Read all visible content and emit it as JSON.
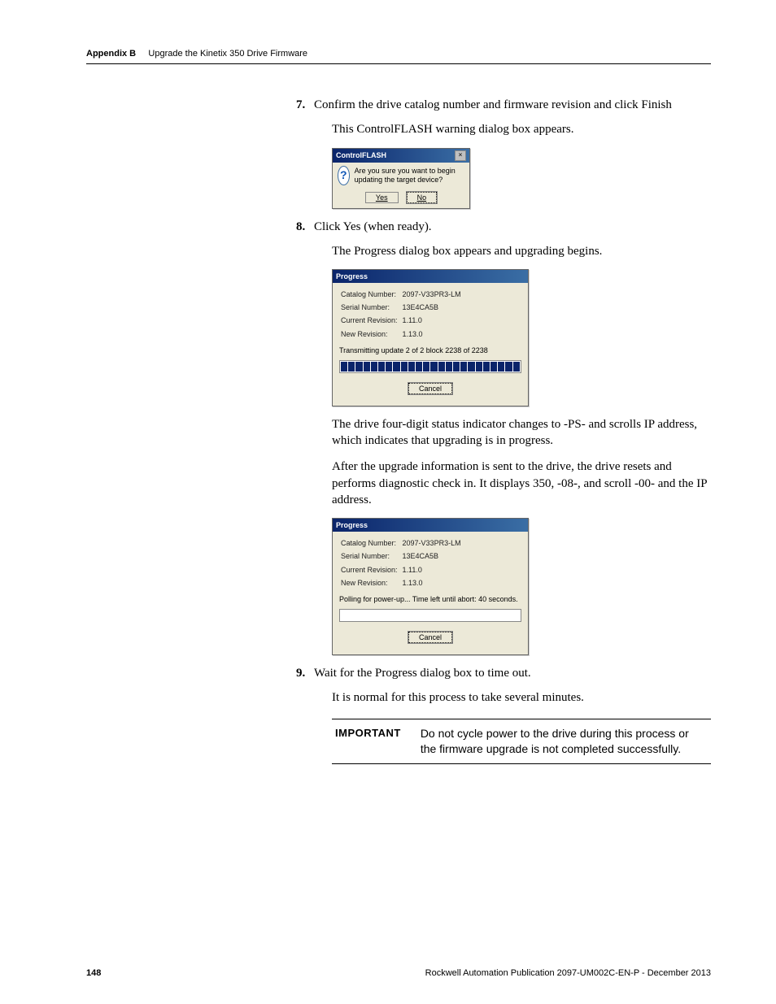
{
  "header": {
    "appendix": "Appendix B",
    "title": "Upgrade the Kinetix 350 Drive Firmware"
  },
  "steps": {
    "s7": {
      "num": "7.",
      "text": "Confirm the drive catalog number and firmware revision and click Finish",
      "sub": "This ControlFLASH warning dialog box appears."
    },
    "s8": {
      "num": "8.",
      "text": "Click Yes (when ready).",
      "sub": "The Progress dialog box appears and upgrading begins.",
      "after1": "The drive four-digit status indicator changes to -PS- and scrolls IP address, which indicates that upgrading is in progress.",
      "after2": "After the upgrade information is sent to the drive, the drive resets and performs diagnostic check in. It displays 350, -08-, and scroll -00- and the IP address."
    },
    "s9": {
      "num": "9.",
      "text": "Wait for the Progress dialog box to time out.",
      "sub": "It is normal for this process to take several minutes."
    }
  },
  "dlg_confirm": {
    "title": "ControlFLASH",
    "message": "Are you sure you want to begin updating the target device?",
    "yes": "Yes",
    "no": "No"
  },
  "dlg_progress1": {
    "title": "Progress",
    "labels": {
      "catalog": "Catalog Number:",
      "serial": "Serial Number:",
      "current": "Current Revision:",
      "new": "New Revision:"
    },
    "values": {
      "catalog": "2097-V33PR3-LM",
      "serial": "13E4CA5B",
      "current": "1.11.0",
      "new": "1.13.0"
    },
    "status": "Transmitting update 2 of 2  block 2238 of 2238",
    "cancel": "Cancel"
  },
  "dlg_progress2": {
    "title": "Progress",
    "values": {
      "catalog": "2097-V33PR3-LM",
      "serial": "13E4CA5B",
      "current": "1.11.0",
      "new": "1.13.0"
    },
    "status": "Polling for power-up... Time left until abort: 40 seconds.",
    "cancel": "Cancel"
  },
  "important": {
    "label": "IMPORTANT",
    "text": "Do not cycle power to the drive during this process or the firmware upgrade is not completed successfully."
  },
  "footer": {
    "page": "148",
    "pub": "Rockwell Automation Publication 2097-UM002C-EN-P - December 2013"
  }
}
